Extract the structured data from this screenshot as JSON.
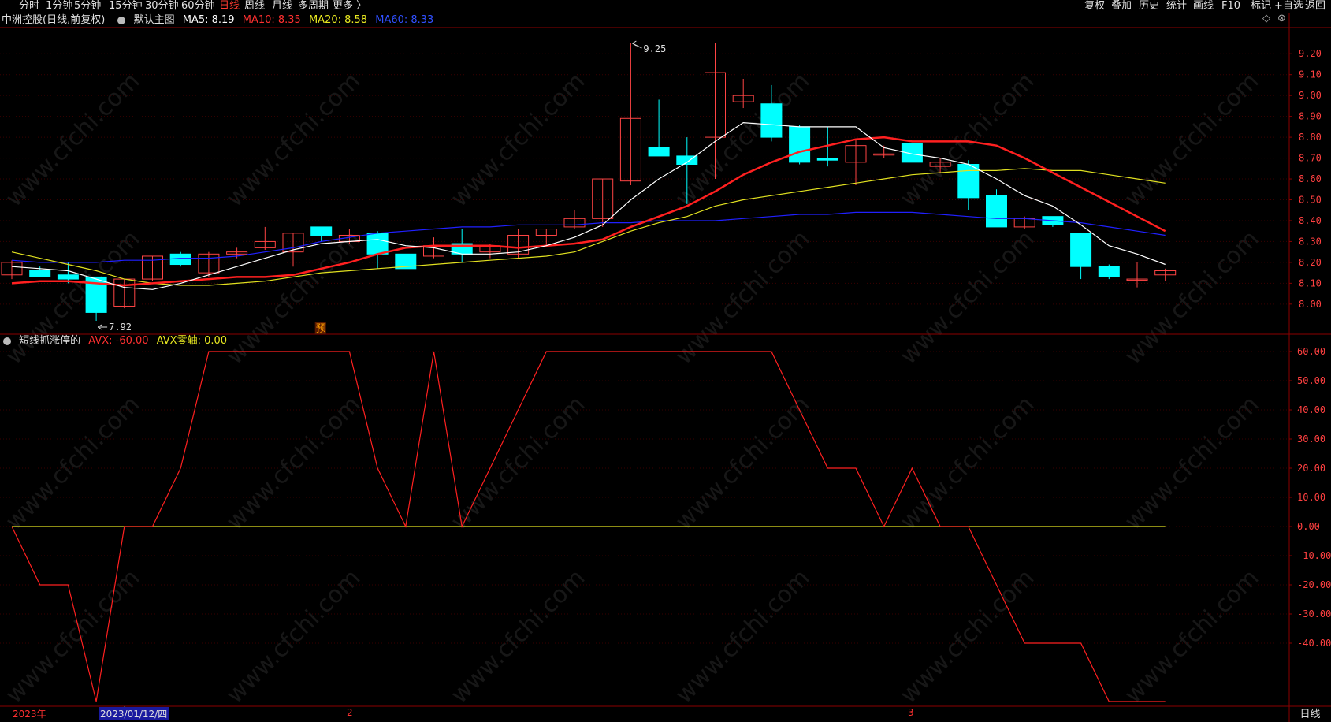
{
  "toolbar": {
    "left_items": [
      "分时",
      "1分钟",
      "5分钟",
      "15分钟",
      "30分钟",
      "60分钟",
      "日线",
      "周线",
      "月线",
      "多周期",
      "更多"
    ],
    "active": "日线",
    "right_items": [
      "复权",
      "叠加",
      "历史",
      "统计",
      "画线",
      "F10",
      "+自选",
      "返回"
    ],
    "mark_label": "标记"
  },
  "main_info": {
    "title": "中洲控股(日线,前复权)",
    "template": "默认主图",
    "ma5": "MA5: 8.19",
    "ma10": "MA10: 8.35",
    "ma20": "MA20: 8.58",
    "ma60": "MA60: 8.33"
  },
  "sub_info": {
    "name": "短线抓涨停的",
    "avx": "AVX: -60.00",
    "avx_zero": "AVX零轴: 0.00"
  },
  "annotations": {
    "high": "9.25",
    "low": "7.92",
    "yu": "预"
  },
  "price_axis": [
    "9.20",
    "9.10",
    "9.00",
    "8.90",
    "8.80",
    "8.70",
    "8.60",
    "8.50",
    "8.40",
    "8.30",
    "8.20",
    "8.10",
    "8.00"
  ],
  "avx_axis": [
    "60.00",
    "50.00",
    "40.00",
    "30.00",
    "20.00",
    "10.00",
    "0.00",
    "-10.00",
    "-20.00",
    "-30.00",
    "-40.00"
  ],
  "x_labels": {
    "year": "2023年",
    "date": "2023/01/12/四",
    "m2": "2",
    "m3": "3"
  },
  "bottom_tab": "日线",
  "corner_icons": [
    "◇",
    "⊗"
  ],
  "watermark": "www.cfchi.com",
  "colors": {
    "up": "#ff4444",
    "down": "#00ffff",
    "ma5": "#ffffff",
    "ma10": "#ff2020",
    "ma20": "#e0e020",
    "ma60": "#2020ff",
    "avx": "#ff2020",
    "zero": "#e0e020"
  },
  "chart_data": {
    "type": "candlestick",
    "price_range": [
      7.92,
      9.25
    ],
    "candles": [
      {
        "o": 8.14,
        "h": 8.21,
        "l": 8.12,
        "c": 8.2
      },
      {
        "o": 8.16,
        "h": 8.18,
        "l": 8.13,
        "c": 8.13
      },
      {
        "o": 8.14,
        "h": 8.2,
        "l": 8.1,
        "c": 8.12
      },
      {
        "o": 8.13,
        "h": 8.13,
        "l": 7.92,
        "c": 7.96
      },
      {
        "o": 7.99,
        "h": 8.12,
        "l": 7.98,
        "c": 8.12
      },
      {
        "o": 8.12,
        "h": 8.23,
        "l": 8.11,
        "c": 8.23
      },
      {
        "o": 8.24,
        "h": 8.25,
        "l": 8.18,
        "c": 8.19
      },
      {
        "o": 8.15,
        "h": 8.25,
        "l": 8.13,
        "c": 8.24
      },
      {
        "o": 8.24,
        "h": 8.27,
        "l": 8.22,
        "c": 8.25
      },
      {
        "o": 8.27,
        "h": 8.37,
        "l": 8.26,
        "c": 8.3
      },
      {
        "o": 8.25,
        "h": 8.34,
        "l": 8.18,
        "c": 8.34
      },
      {
        "o": 8.37,
        "h": 8.37,
        "l": 8.3,
        "c": 8.33
      },
      {
        "o": 8.3,
        "h": 8.36,
        "l": 8.29,
        "c": 8.33
      },
      {
        "o": 8.34,
        "h": 8.35,
        "l": 8.17,
        "c": 8.24
      },
      {
        "o": 8.24,
        "h": 8.24,
        "l": 8.17,
        "c": 8.17
      },
      {
        "o": 8.23,
        "h": 8.32,
        "l": 8.22,
        "c": 8.28
      },
      {
        "o": 8.29,
        "h": 8.36,
        "l": 8.2,
        "c": 8.24
      },
      {
        "o": 8.25,
        "h": 8.29,
        "l": 8.22,
        "c": 8.28
      },
      {
        "o": 8.24,
        "h": 8.36,
        "l": 8.22,
        "c": 8.33
      },
      {
        "o": 8.33,
        "h": 8.36,
        "l": 8.28,
        "c": 8.36
      },
      {
        "o": 8.37,
        "h": 8.45,
        "l": 8.36,
        "c": 8.41
      },
      {
        "o": 8.41,
        "h": 8.6,
        "l": 8.37,
        "c": 8.6
      },
      {
        "o": 8.59,
        "h": 9.25,
        "l": 8.57,
        "c": 8.89
      },
      {
        "o": 8.75,
        "h": 8.98,
        "l": 8.72,
        "c": 8.71
      },
      {
        "o": 8.71,
        "h": 8.8,
        "l": 8.48,
        "c": 8.67
      },
      {
        "o": 8.8,
        "h": 9.25,
        "l": 8.6,
        "c": 9.11
      },
      {
        "o": 8.97,
        "h": 9.08,
        "l": 8.94,
        "c": 9.0
      },
      {
        "o": 8.96,
        "h": 9.05,
        "l": 8.78,
        "c": 8.8
      },
      {
        "o": 8.85,
        "h": 8.86,
        "l": 8.67,
        "c": 8.68
      },
      {
        "o": 8.7,
        "h": 8.85,
        "l": 8.66,
        "c": 8.69
      },
      {
        "o": 8.68,
        "h": 8.79,
        "l": 8.57,
        "c": 8.76
      },
      {
        "o": 8.72,
        "h": 8.76,
        "l": 8.7,
        "c": 8.72
      },
      {
        "o": 8.77,
        "h": 8.77,
        "l": 8.68,
        "c": 8.68
      },
      {
        "o": 8.66,
        "h": 8.7,
        "l": 8.63,
        "c": 8.68
      },
      {
        "o": 8.67,
        "h": 8.69,
        "l": 8.45,
        "c": 8.51
      },
      {
        "o": 8.52,
        "h": 8.55,
        "l": 8.37,
        "c": 8.37
      },
      {
        "o": 8.37,
        "h": 8.42,
        "l": 8.36,
        "c": 8.41
      },
      {
        "o": 8.42,
        "h": 8.42,
        "l": 8.37,
        "c": 8.38
      },
      {
        "o": 8.34,
        "h": 8.34,
        "l": 8.12,
        "c": 8.18
      },
      {
        "o": 8.18,
        "h": 8.19,
        "l": 8.12,
        "c": 8.13
      },
      {
        "o": 8.12,
        "h": 8.2,
        "l": 8.08,
        "c": 8.12
      },
      {
        "o": 8.14,
        "h": 8.17,
        "l": 8.11,
        "c": 8.16
      }
    ],
    "ma5": [
      8.18,
      8.17,
      8.16,
      8.12,
      8.08,
      8.07,
      8.1,
      8.14,
      8.18,
      8.22,
      8.26,
      8.29,
      8.3,
      8.31,
      8.28,
      8.27,
      8.24,
      8.24,
      8.25,
      8.28,
      8.32,
      8.38,
      8.5,
      8.6,
      8.68,
      8.78,
      8.87,
      8.86,
      8.85,
      8.85,
      8.85,
      8.75,
      8.72,
      8.7,
      8.67,
      8.6,
      8.52,
      8.47,
      8.38,
      8.28,
      8.24,
      8.19
    ],
    "ma10": [
      8.1,
      8.11,
      8.11,
      8.1,
      8.09,
      8.1,
      8.11,
      8.12,
      8.13,
      8.13,
      8.14,
      8.17,
      8.2,
      8.24,
      8.27,
      8.28,
      8.28,
      8.28,
      8.27,
      8.28,
      8.29,
      8.31,
      8.37,
      8.42,
      8.47,
      8.54,
      8.62,
      8.68,
      8.73,
      8.76,
      8.79,
      8.8,
      8.78,
      8.78,
      8.78,
      8.76,
      8.7,
      8.63,
      8.56,
      8.49,
      8.42,
      8.35
    ],
    "ma20": [
      8.25,
      8.22,
      8.19,
      8.16,
      8.12,
      8.1,
      8.09,
      8.09,
      8.1,
      8.11,
      8.13,
      8.15,
      8.16,
      8.17,
      8.18,
      8.19,
      8.2,
      8.21,
      8.22,
      8.23,
      8.25,
      8.3,
      8.35,
      8.39,
      8.42,
      8.47,
      8.5,
      8.52,
      8.54,
      8.56,
      8.58,
      8.6,
      8.62,
      8.63,
      8.64,
      8.64,
      8.65,
      8.64,
      8.64,
      8.62,
      8.6,
      8.58
    ],
    "ma60": [
      8.21,
      8.2,
      8.2,
      8.2,
      8.21,
      8.21,
      8.22,
      8.22,
      8.23,
      8.25,
      8.27,
      8.3,
      8.32,
      8.34,
      8.35,
      8.36,
      8.37,
      8.37,
      8.38,
      8.38,
      8.38,
      8.39,
      8.39,
      8.4,
      8.4,
      8.4,
      8.41,
      8.42,
      8.43,
      8.43,
      8.44,
      8.44,
      8.44,
      8.43,
      8.42,
      8.41,
      8.41,
      8.4,
      8.39,
      8.37,
      8.35,
      8.33
    ],
    "avx": [
      0,
      -20,
      -20,
      -60,
      0,
      0,
      20,
      60,
      60,
      60,
      60,
      60,
      60,
      20,
      0,
      60,
      0,
      20,
      40,
      60,
      60,
      60,
      60,
      60,
      60,
      60,
      60,
      60,
      40,
      20,
      20,
      0,
      20,
      0,
      0,
      -20,
      -40,
      -40,
      -40,
      -60,
      -60,
      -60
    ],
    "avx_zero": 0,
    "avx_range": [
      -60,
      60
    ]
  }
}
